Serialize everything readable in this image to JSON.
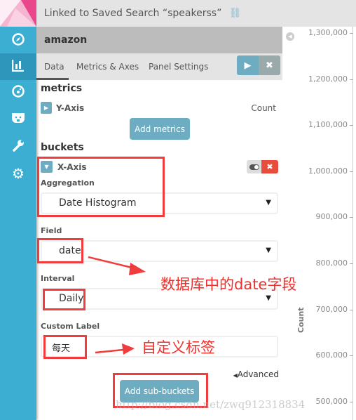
{
  "header": {
    "linked_text": "Linked to Saved Search “speakerss”",
    "unlink_icon": "unlink-icon"
  },
  "sidebar": {
    "items": [
      {
        "icon": "compass-icon",
        "label": "Discover"
      },
      {
        "icon": "bar-chart-icon",
        "label": "Visualize",
        "active": true
      },
      {
        "icon": "dashboard-icon",
        "label": "Dashboard"
      },
      {
        "icon": "bear-icon",
        "label": "Timelion"
      },
      {
        "icon": "wrench-icon",
        "label": "Dev Tools"
      },
      {
        "icon": "gear-icon",
        "label": "Management"
      }
    ]
  },
  "panel": {
    "title": "amazon",
    "tabs": [
      {
        "label": "Data",
        "active": true
      },
      {
        "label": "Metrics & Axes"
      },
      {
        "label": "Panel Settings"
      }
    ],
    "metrics_heading": "metrics",
    "y_axis": {
      "label": "Y-Axis",
      "value": "Count"
    },
    "add_metrics": "Add metrics",
    "buckets_heading": "buckets",
    "x_axis": {
      "label": "X-Axis"
    },
    "aggregation": {
      "label": "Aggregation",
      "value": "Date Histogram"
    },
    "field": {
      "label": "Field",
      "value": "date"
    },
    "interval": {
      "label": "Interval",
      "value": "Daily"
    },
    "custom_label": {
      "label": "Custom Label",
      "value": "每天"
    },
    "advanced": "Advanced",
    "add_sub_buckets": "Add sub-buckets"
  },
  "chart_data": {
    "type": "bar",
    "ylabel": "Count",
    "yticks": [
      "1,300,000",
      "1,200,000",
      "1,100,000",
      "1,000,000",
      "900,000",
      "800,000",
      "700,000",
      "600,000",
      "500,000"
    ]
  },
  "annotations": {
    "field_note": "数据库中的date字段",
    "label_note": "自定义标签",
    "color": "#f03c3c"
  },
  "watermark": "http://blog.csdn.net/zwq912318834"
}
